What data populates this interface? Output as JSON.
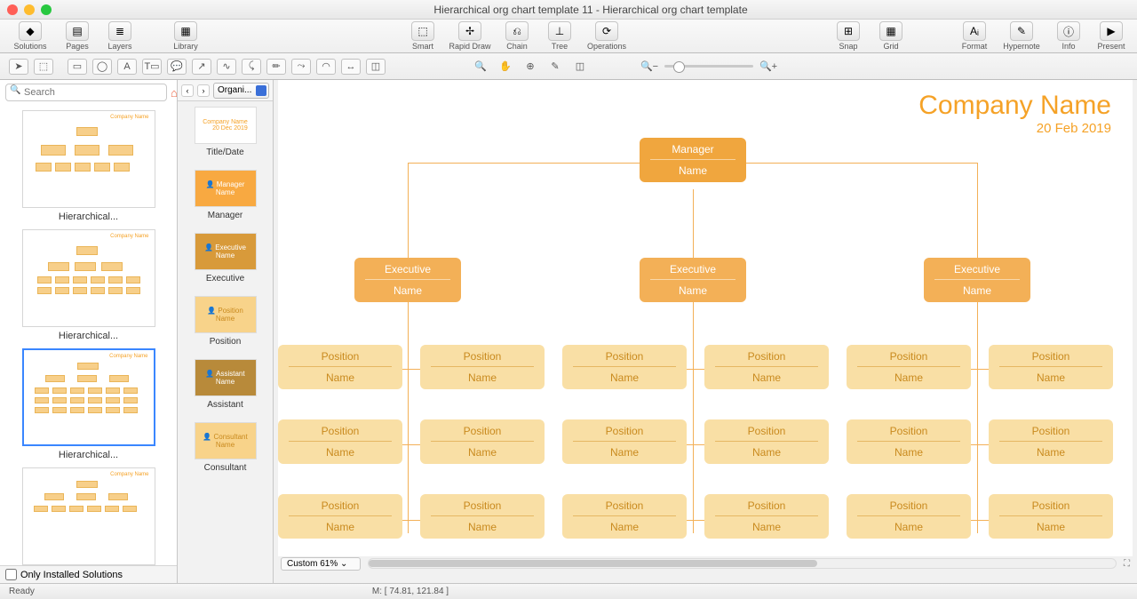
{
  "window": {
    "title": "Hierarchical org chart template 11 - Hierarchical org chart template"
  },
  "toolbar": {
    "solutions": "Solutions",
    "pages": "Pages",
    "layers": "Layers",
    "library": "Library",
    "smart": "Smart",
    "rapid_draw": "Rapid Draw",
    "chain": "Chain",
    "tree": "Tree",
    "operations": "Operations",
    "snap": "Snap",
    "grid": "Grid",
    "format": "Format",
    "hypernote": "Hypernote",
    "info": "Info",
    "present": "Present"
  },
  "search": {
    "placeholder": "Search"
  },
  "thumbs": {
    "cap": "Hierarchical...",
    "only_installed": "Only Installed Solutions"
  },
  "shape_panel": {
    "selector": "Organi...",
    "items": [
      "Title/Date",
      "Manager",
      "Executive",
      "Position",
      "Assistant",
      "Consultant"
    ]
  },
  "chart": {
    "company": "Company Name",
    "date": "20 Feb 2019",
    "manager": {
      "title": "Manager",
      "name": "Name"
    },
    "exec": {
      "title": "Executive",
      "name": "Name"
    },
    "position": {
      "title": "Position",
      "name": "Name"
    }
  },
  "canvas": {
    "zoom": "Custom 61%"
  },
  "status": {
    "ready": "Ready",
    "coord": "M: [ 74.81, 121.84 ]"
  }
}
